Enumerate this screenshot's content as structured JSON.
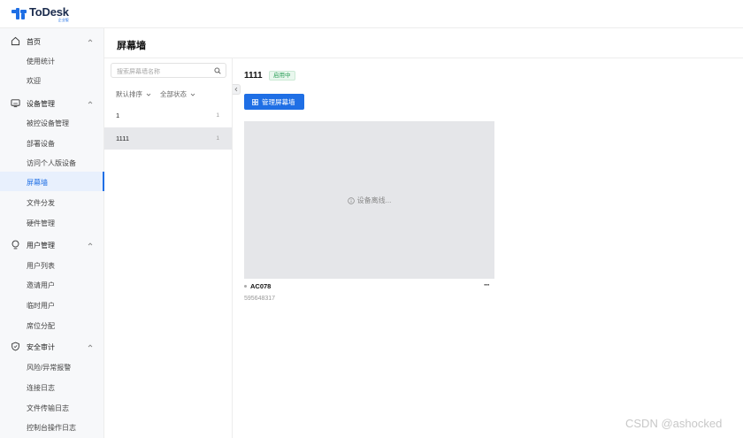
{
  "app": {
    "name": "ToDesk",
    "edition": "企业版",
    "brand_color": "#1f6fe5"
  },
  "sidebar": {
    "groups": [
      {
        "label": "首页",
        "icon": "home-icon",
        "items": [
          "使用统计",
          "欢迎"
        ]
      },
      {
        "label": "设备管理",
        "icon": "monitor-icon",
        "items": [
          "被控设备管理",
          "部署设备",
          "访问个人版设备",
          "屏幕墙",
          "文件分发",
          "硬件管理"
        ]
      },
      {
        "label": "用户管理",
        "icon": "user-icon",
        "items": [
          "用户列表",
          "邀请用户",
          "临时用户",
          "席位分配"
        ]
      },
      {
        "label": "安全审计",
        "icon": "shield-icon",
        "items": [
          "风险/异常报警",
          "连接日志",
          "文件传输日志",
          "控制台操作日志"
        ]
      }
    ],
    "active_item": "屏幕墙"
  },
  "page": {
    "title": "屏幕墙"
  },
  "wall_list": {
    "search_placeholder": "搜索屏幕墙名称",
    "sort_label": "默认排序",
    "status_filter_label": "全部状态",
    "rows": [
      {
        "name": "1",
        "count": "1",
        "selected": false
      },
      {
        "name": "1111",
        "count": "1",
        "selected": true
      }
    ]
  },
  "detail": {
    "wall_name": "1111",
    "status": "启用中",
    "manage_button": "管理屏幕墙",
    "device": {
      "offline_text": "设备离线...",
      "name": "AC078",
      "id": "595648317",
      "more": "···"
    }
  },
  "watermark": "CSDN @ashocked"
}
